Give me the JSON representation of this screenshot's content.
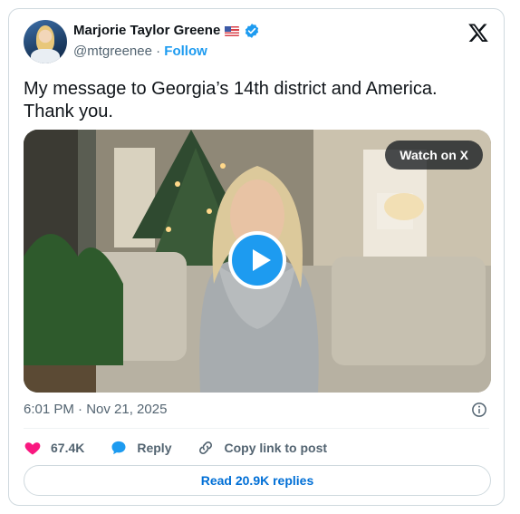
{
  "author": {
    "name": "Marjorie Taylor Greene",
    "handle": "@mtgreenee",
    "separator": "·",
    "follow_label": "Follow"
  },
  "icons": {
    "flag": "us-flag-icon",
    "verified": "verified-badge-icon",
    "brand": "x-logo-icon",
    "like": "heart-icon",
    "reply": "speech-bubble-icon",
    "copy_link": "link-icon",
    "info": "info-icon"
  },
  "tweet": {
    "text": "My message to Georgia’s 14th district and America. Thank you."
  },
  "video": {
    "watch_label": "Watch on X"
  },
  "meta": {
    "timestamp": "6:01 PM · Nov 21, 2025"
  },
  "actions": {
    "likes": "67.4K",
    "reply_label": "Reply",
    "copy_label": "Copy link to post"
  },
  "footer": {
    "read_replies_label": "Read 20.9K replies"
  },
  "colors": {
    "accent": "#1d9bf0",
    "like": "#f91880",
    "muted_text": "#536471",
    "border": "#cfd9de"
  }
}
